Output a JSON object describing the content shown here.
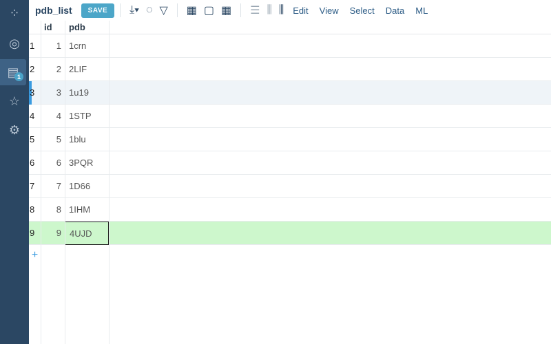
{
  "sidebar": {
    "items": [
      {
        "name": "logo"
      },
      {
        "name": "browse"
      },
      {
        "name": "tables",
        "badge": "1"
      },
      {
        "name": "favorites"
      },
      {
        "name": "settings"
      }
    ]
  },
  "toolbar": {
    "title": "pdb_list",
    "save_label": "SAVE",
    "menus": [
      "Edit",
      "View",
      "Select",
      "Data",
      "ML"
    ]
  },
  "table": {
    "columns": [
      "id",
      "pdb"
    ],
    "rows": [
      {
        "n": "1",
        "id": "1",
        "pdb": "1crn"
      },
      {
        "n": "2",
        "id": "2",
        "pdb": "2LIF"
      },
      {
        "n": "3",
        "id": "3",
        "pdb": "1u19"
      },
      {
        "n": "4",
        "id": "4",
        "pdb": "1STP"
      },
      {
        "n": "5",
        "id": "5",
        "pdb": "1blu"
      },
      {
        "n": "6",
        "id": "6",
        "pdb": "3PQR"
      },
      {
        "n": "7",
        "id": "7",
        "pdb": "1D66"
      },
      {
        "n": "8",
        "id": "8",
        "pdb": "1IHM"
      },
      {
        "n": "9",
        "id": "9",
        "pdb": "4UJD"
      }
    ],
    "add_label": "+"
  },
  "colors": {
    "sidebar": "#2b4763",
    "accent": "#4ca6c8",
    "selected_row": "#cdf7cc"
  }
}
